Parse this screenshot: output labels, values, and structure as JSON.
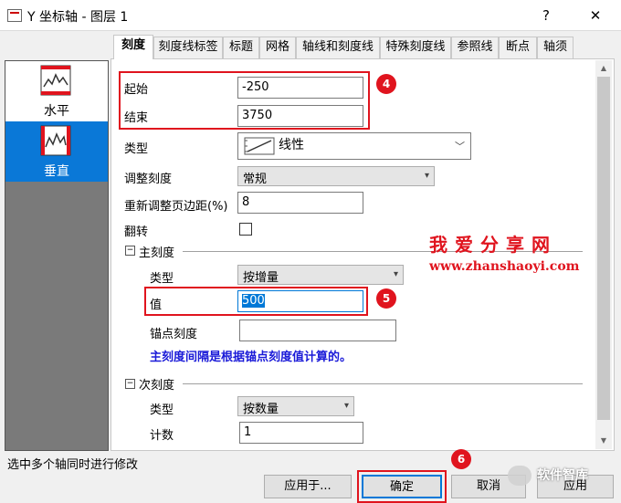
{
  "window": {
    "title": "Y 坐标轴 - 图层 1",
    "help": "?",
    "close": "✕"
  },
  "tabs": [
    "刻度",
    "刻度线标签",
    "标题",
    "网格",
    "轴线和刻度线",
    "特殊刻度线",
    "参照线",
    "断点",
    "轴须"
  ],
  "axes": [
    {
      "label": "水平",
      "icon": "horizontal-axis-icon"
    },
    {
      "label": "垂直",
      "icon": "vertical-axis-icon"
    }
  ],
  "scale": {
    "from_label": "起始",
    "from_value": "-250",
    "to_label": "结束",
    "to_value": "3750",
    "type_label": "类型",
    "type_value": "线性",
    "rescale_label": "调整刻度",
    "rescale_value": "常规",
    "margin_label": "重新调整页边距(%)",
    "margin_value": "8",
    "reverse_label": "翻转"
  },
  "major": {
    "header": "主刻度",
    "type_label": "类型",
    "type_value": "按增量",
    "value_label": "值",
    "value": "500",
    "anchor_label": "锚点刻度",
    "anchor_value": "",
    "note": "主刻度间隔是根据锚点刻度值计算的。"
  },
  "minor": {
    "header": "次刻度",
    "type_label": "类型",
    "type_value": "按数量",
    "count_label": "计数",
    "count_value": "1"
  },
  "badges": [
    "4",
    "5",
    "6"
  ],
  "watermark": {
    "line1": "我爱分享网",
    "line2": "www.zhanshaoyi.com",
    "wechat": "软件智库"
  },
  "status": "选中多个轴同时进行修改",
  "buttons": {
    "apply_to": "应用于...",
    "ok": "确定",
    "cancel": "取消",
    "apply": "应用"
  },
  "colors": {
    "accent": "#0078d7",
    "highlight": "#e0141e",
    "selected_axis": "#0a78d7"
  }
}
